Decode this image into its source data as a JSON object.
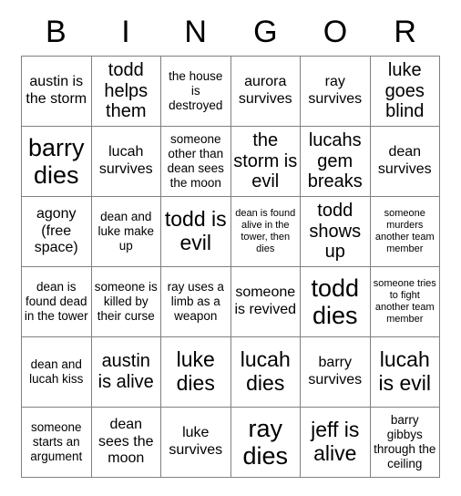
{
  "card": {
    "header_letters": [
      "B",
      "I",
      "N",
      "G",
      "O",
      "R"
    ],
    "columns": 6,
    "rows": 6,
    "border_color": "#808080",
    "text_color": "#000000",
    "background_color": "#ffffff",
    "free_space_cell": "agony (free space)",
    "cells": [
      [
        {
          "text": "austin is the storm",
          "size": "md"
        },
        {
          "text": "todd helps them",
          "size": "lg"
        },
        {
          "text": "the house is destroyed",
          "size": "sm"
        },
        {
          "text": "aurora survives",
          "size": "md"
        },
        {
          "text": "ray survives",
          "size": "md"
        },
        {
          "text": "luke goes blind",
          "size": "lg"
        }
      ],
      [
        {
          "text": "barry dies",
          "size": "xxl"
        },
        {
          "text": "lucah survives",
          "size": "md"
        },
        {
          "text": "someone other than dean sees the moon",
          "size": "sm"
        },
        {
          "text": "the storm is evil",
          "size": "lg"
        },
        {
          "text": "lucahs gem breaks",
          "size": "lg"
        },
        {
          "text": "dean survives",
          "size": "md"
        }
      ],
      [
        {
          "text": "agony (free space)",
          "size": "md"
        },
        {
          "text": "dean and luke make up",
          "size": "sm"
        },
        {
          "text": "todd is evil",
          "size": "xl"
        },
        {
          "text": "dean is found alive in the tower, then dies",
          "size": "xs"
        },
        {
          "text": "todd shows up",
          "size": "lg"
        },
        {
          "text": "someone murders another team member",
          "size": "xs"
        }
      ],
      [
        {
          "text": "dean is found dead in the tower",
          "size": "sm"
        },
        {
          "text": "someone is killed by their curse",
          "size": "sm"
        },
        {
          "text": "ray uses a limb as a weapon",
          "size": "sm"
        },
        {
          "text": "someone is revived",
          "size": "md"
        },
        {
          "text": "todd dies",
          "size": "xxl"
        },
        {
          "text": "someone tries to fight another team member",
          "size": "xs"
        }
      ],
      [
        {
          "text": "dean and lucah kiss",
          "size": "sm"
        },
        {
          "text": "austin is alive",
          "size": "lg"
        },
        {
          "text": "luke dies",
          "size": "xl"
        },
        {
          "text": "lucah dies",
          "size": "xl"
        },
        {
          "text": "barry survives",
          "size": "md"
        },
        {
          "text": "lucah is evil",
          "size": "xl"
        }
      ],
      [
        {
          "text": "someone starts an argument",
          "size": "sm"
        },
        {
          "text": "dean sees the moon",
          "size": "md"
        },
        {
          "text": "luke survives",
          "size": "md"
        },
        {
          "text": "ray dies",
          "size": "xxl"
        },
        {
          "text": "jeff is alive",
          "size": "xl"
        },
        {
          "text": "barry gibbys through the ceiling",
          "size": "sm"
        }
      ]
    ]
  }
}
